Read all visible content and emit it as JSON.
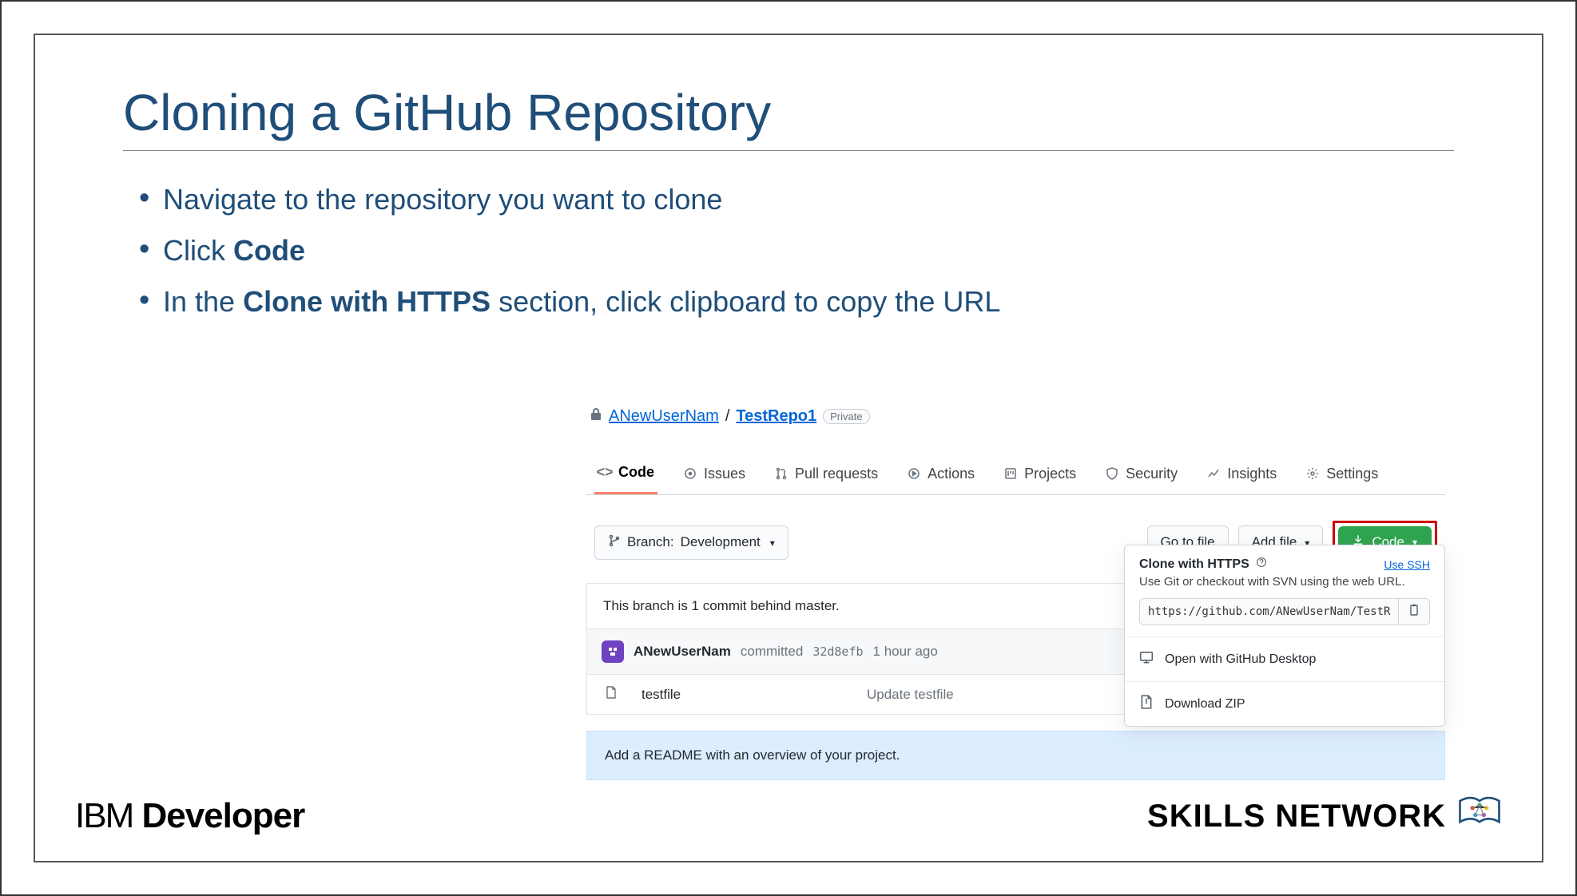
{
  "slide": {
    "title": "Cloning a GitHub Repository",
    "bullets": {
      "b1_pre": "Navigate to the repository you want to clone",
      "b2_pre": "Click ",
      "b2_bold": "Code",
      "b3_pre": "In the ",
      "b3_bold": "Clone with HTTPS",
      "b3_post": " section, click clipboard to copy the URL"
    }
  },
  "github": {
    "owner": "ANewUserNam",
    "separator": "/",
    "repo": "TestRepo1",
    "visibility": "Private",
    "tabs": {
      "code": "Code",
      "issues": "Issues",
      "pulls": "Pull requests",
      "actions": "Actions",
      "projects": "Projects",
      "security": "Security",
      "insights": "Insights",
      "settings": "Settings"
    },
    "branch": {
      "label": "Branch:",
      "name": "Development"
    },
    "buttons": {
      "gotofile": "Go to file",
      "addfile": "Add file",
      "code": "Code"
    },
    "infobar": "This branch is 1 commit behind master.",
    "commit": {
      "user": "ANewUserNam",
      "verb": "committed",
      "sha": "32d8efb",
      "time": "1 hour ago"
    },
    "file": {
      "name": "testfile",
      "message": "Update testfile"
    },
    "readme_banner": "Add a README with an overview of your project.",
    "popover": {
      "title": "Clone with HTTPS",
      "use_ssh": "Use SSH",
      "desc": "Use Git or checkout with SVN using the web URL.",
      "url": "https://github.com/ANewUserNam/TestRep",
      "open_desktop": "Open with GitHub Desktop",
      "download_zip": "Download ZIP"
    }
  },
  "footer": {
    "ibm": "IBM",
    "developer": "Developer",
    "skills": "SKILLS NETWORK"
  }
}
